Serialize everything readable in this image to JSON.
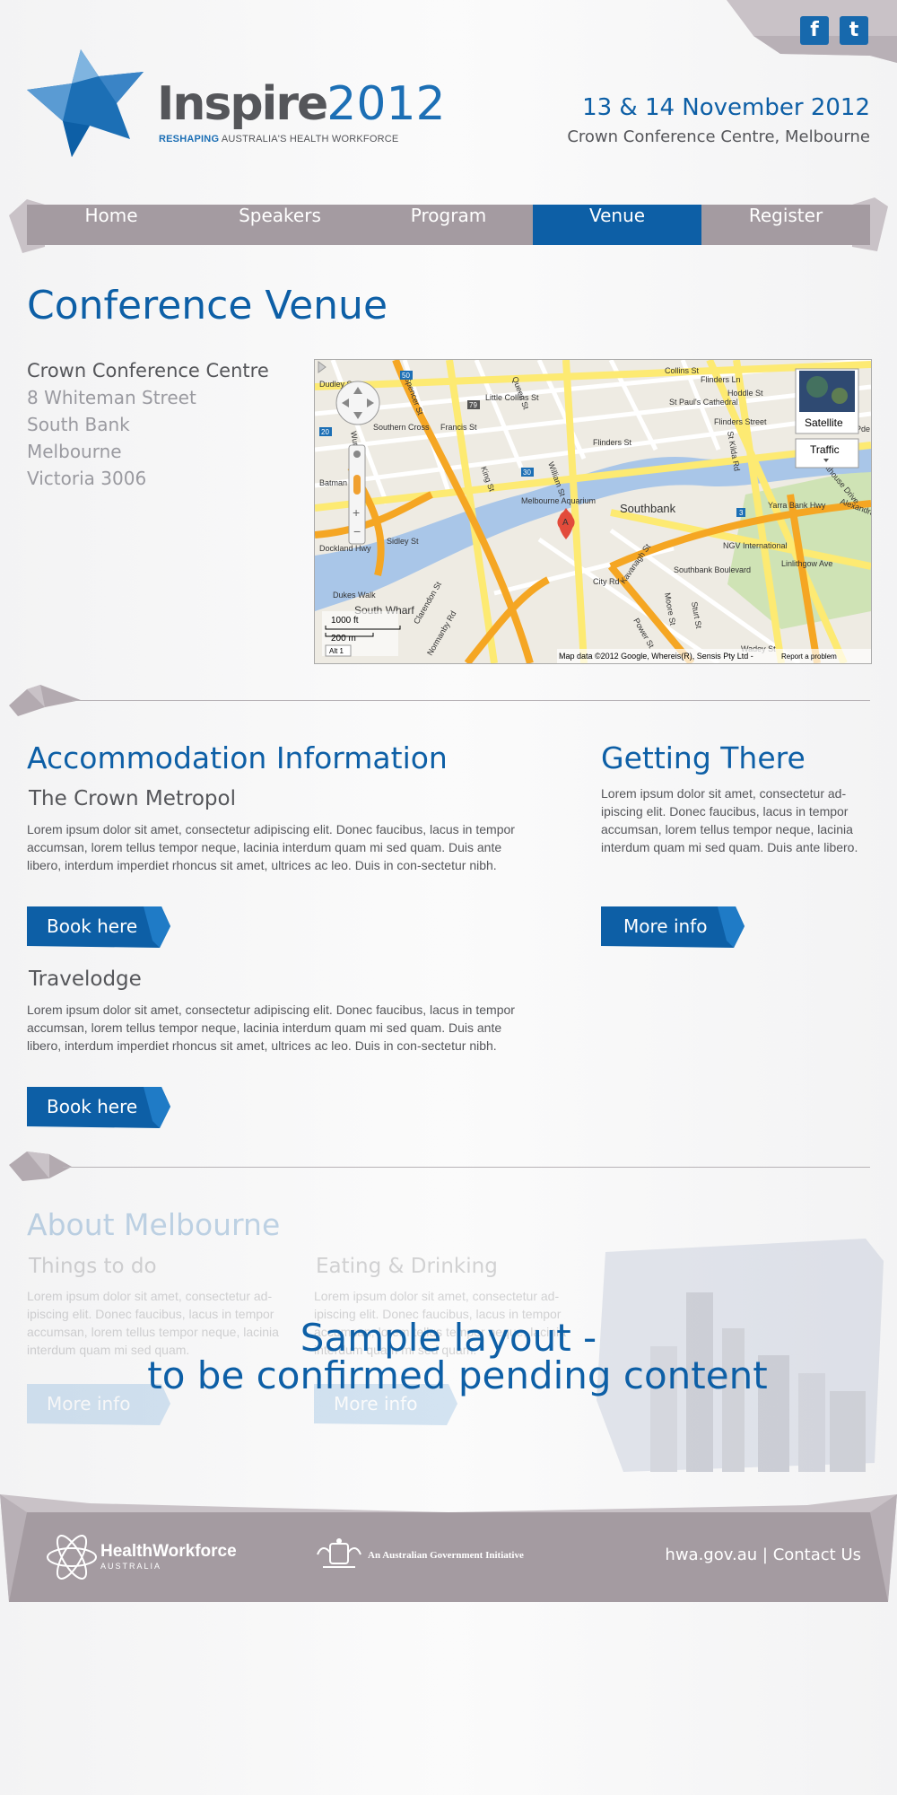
{
  "header": {
    "logo_word": "Inspire",
    "logo_year": "2012",
    "tagline_bold": "RESHAPING",
    "tagline_rest": " AUSTRALIA'S HEALTH WORKFORCE",
    "date": "13 & 14 November 2012",
    "venue": "Crown Conference Centre, Melbourne",
    "social": [
      {
        "icon": "facebook-icon",
        "glyph": "f"
      },
      {
        "icon": "twitter-icon",
        "glyph": "t"
      }
    ]
  },
  "nav": {
    "items": [
      "Home",
      "Speakers",
      "Program",
      "Venue",
      "Register"
    ],
    "active": "Venue"
  },
  "venue": {
    "title": "Conference Venue",
    "name": "Crown Conference Centre",
    "address": [
      "8 Whiteman Street",
      "South Bank",
      "Melbourne",
      "Victoria 3006"
    ]
  },
  "map": {
    "satellite_label": "Satellite",
    "traffic_label": "Traffic",
    "scale_ft": "1000 ft",
    "scale_m": "200 m",
    "alt_label": "Alt 1",
    "attribution": "Map data ©2012 Google, Whereis(R), Sensis Pty Ltd -",
    "report_label": "Report a problem",
    "marker_label": "A",
    "labels": [
      "Southbank",
      "South Wharf",
      "Southern Cross",
      "Melbourne Aquarium",
      "St Paul's Cathedral",
      "Flinders Street",
      "Dockland Hwy",
      "Southbank Boulevard",
      "City Rd",
      "NGV International",
      "Yarra Bank Hwy",
      "Linlithgow Ave",
      "Collins St",
      "Flinders Ln",
      "Flinders St",
      "Little Collins St",
      "Francis St",
      "King St",
      "William St",
      "Queen St",
      "Spencer St",
      "Sidley St",
      "Dukes Walk",
      "Clarendon St",
      "Normanby Rd",
      "Power St",
      "Sturt St",
      "Kavanagh St",
      "Moore St",
      "Wadey St",
      "St Kilda Rd",
      "Boathouse Drive",
      "Alexandra Ave",
      "Wurundjeri Way",
      "Batman St",
      "Dudley St",
      "Hoddle St",
      "Alexandra Pde"
    ],
    "road_numbers": [
      "50",
      "79",
      "20",
      "30",
      "3"
    ]
  },
  "accommodation": {
    "title": "Accommodation Information",
    "hotels": [
      {
        "name": "The Crown Metropol",
        "text": "Lorem ipsum dolor sit amet, consectetur adipiscing elit. Donec faucibus, lacus in tempor accumsan, lorem tellus tempor neque, lacinia interdum quam mi sed quam. Duis ante libero, interdum imperdiet rhoncus sit amet, ultrices ac leo. Duis in con-sectetur nibh.",
        "button": "Book here"
      },
      {
        "name": "Travelodge",
        "text": "Lorem ipsum dolor sit amet, consectetur adipiscing elit. Donec faucibus, lacus in tempor accumsan, lorem tellus tempor neque, lacinia interdum quam mi sed quam. Duis ante libero, interdum imperdiet rhoncus sit amet, ultrices ac leo. Duis in con-sectetur nibh.",
        "button": "Book here"
      }
    ]
  },
  "getting_there": {
    "title": "Getting There",
    "text": "Lorem ipsum dolor sit amet, consectetur ad-ipiscing elit. Donec faucibus, lacus in tempor accumsan, lorem tellus tempor neque, lacinia interdum quam mi sed quam. Duis ante libero.",
    "button": "More info"
  },
  "about": {
    "title": "About Melbourne",
    "things": {
      "title": "Things to do",
      "text": "Lorem ipsum dolor sit amet, consectetur ad-ipiscing elit. Donec faucibus, lacus in tempor accumsan, lorem tellus tempor neque, lacinia interdum quam mi sed quam.",
      "button": "More info"
    },
    "eating": {
      "title": "Eating & Drinking",
      "text": "Lorem ipsum dolor sit amet, consectetur ad-ipiscing elit. Donec faucibus, lacus in tempor accumsan, lorem tellus tempor neque, lacinia interdum quam mi sed quam.",
      "button": "More info"
    },
    "overlay_line1": "Sample layout -",
    "overlay_line2": "to be confirmed pending content"
  },
  "footer": {
    "hwa_name": "HealthWorkforce",
    "hwa_sub": "AUSTRALIA",
    "gov_text": "An Australian Government Initiative",
    "site": "hwa.gov.au",
    "separator": " | ",
    "contact": "Contact Us"
  },
  "colors": {
    "brand_blue": "#0d5fa6",
    "nav_grey": "#a49ba1",
    "text_grey": "#55565a"
  }
}
